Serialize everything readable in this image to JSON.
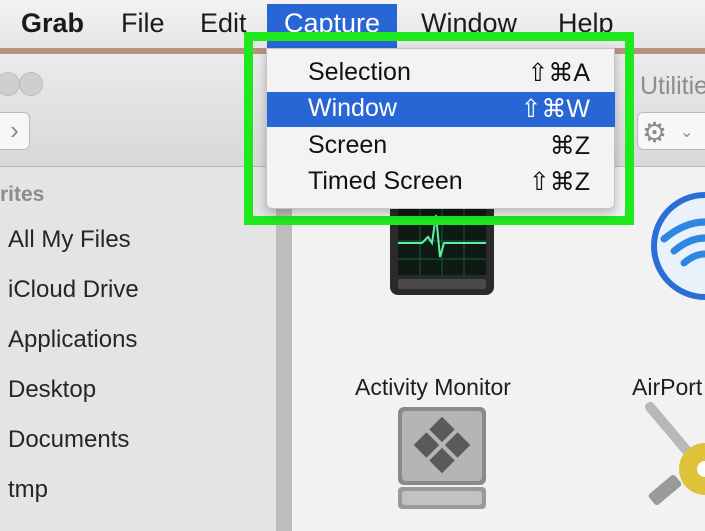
{
  "menubar": {
    "app": "Grab",
    "file": "File",
    "edit": "Edit",
    "capture": "Capture",
    "window": "Window",
    "help": "Help"
  },
  "capture_menu": {
    "items": [
      {
        "label": "Selection",
        "shortcut": "⇧⌘A",
        "selected": false
      },
      {
        "label": "Window",
        "shortcut": "⇧⌘W",
        "selected": true
      },
      {
        "label": "Screen",
        "shortcut": "⌘Z",
        "selected": false
      },
      {
        "label": "Timed Screen",
        "shortcut": "⇧⌘Z",
        "selected": false
      }
    ]
  },
  "finder": {
    "title": "Utilitie",
    "sidebar_heading": "rites",
    "sidebar_items": [
      "All My Files",
      "iCloud Drive",
      "Applications",
      "Desktop",
      "Documents",
      "tmp"
    ],
    "apps": [
      {
        "label": "Activity Monitor",
        "icon": "activity-monitor-icon"
      },
      {
        "label": "AirPort",
        "icon": "airport-utility-icon"
      },
      {
        "label": "",
        "icon": "boot-camp-assistant-icon"
      },
      {
        "label": "",
        "icon": "colorsync-utility-icon"
      }
    ]
  },
  "colors": {
    "highlight": "#1fe81f",
    "selection": "#2866d6",
    "window_accent": "#b8927f"
  }
}
